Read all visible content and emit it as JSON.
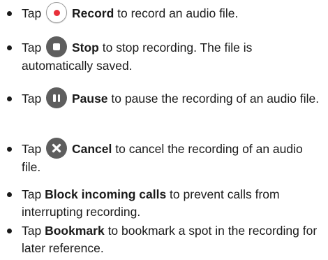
{
  "items": [
    {
      "tap": "Tap",
      "icon": "record-icon",
      "label": "Record",
      "rest": "to record an audio file."
    },
    {
      "tap": "Tap",
      "icon": "stop-icon",
      "label": "Stop",
      "rest": "to stop recording. The file is automatically saved."
    },
    {
      "tap": "Tap",
      "icon": "pause-icon",
      "label": "Pause",
      "rest": "to pause the recording of an audio file."
    },
    {
      "tap": "Tap",
      "icon": "cancel-icon",
      "label": "Cancel",
      "rest": "to cancel the recording of an audio file."
    },
    {
      "tap": "Tap",
      "label": "Block incoming calls",
      "rest": "to prevent calls from interrupting recording."
    },
    {
      "tap": "Tap",
      "label": "Bookmark",
      "rest": "to bookmark a spot in the recording for later reference."
    }
  ],
  "colors": {
    "record_dot": "#e8303a",
    "icon_dark": "#5e5e5e",
    "text": "#1a1a1a"
  }
}
